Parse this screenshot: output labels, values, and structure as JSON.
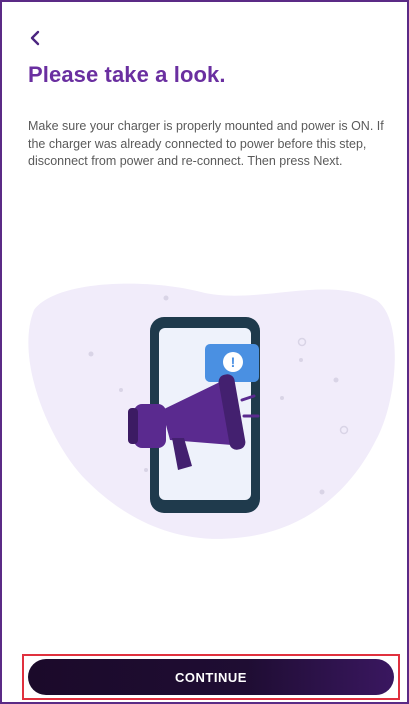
{
  "header": {
    "back_icon": "chevron-left-icon",
    "title": "Please take a look."
  },
  "body": {
    "instructions": "Make sure your charger is properly mounted and power is ON. If the charger was already connected to power before this step, disconnect from power and re-connect. Then press Next."
  },
  "illustration": {
    "icon": "phone-megaphone-alert-illustration",
    "alert_symbol": "!"
  },
  "footer": {
    "continue_label": "CONTINUE"
  },
  "colors": {
    "brand_purple": "#6a2fa0",
    "frame_border": "#5b2a86",
    "button_dark": "#1b0a2a",
    "highlight_red": "#e0313e",
    "blob_lavender": "#f1ecfa",
    "alert_blue": "#4a90e2"
  }
}
